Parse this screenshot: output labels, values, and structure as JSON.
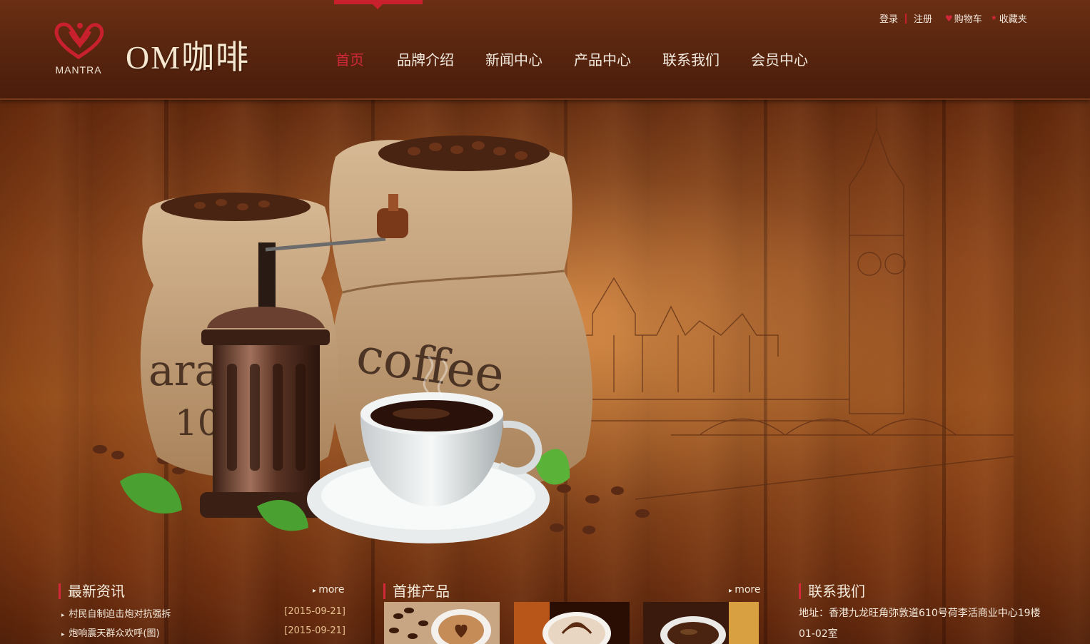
{
  "header": {
    "logo_mark_text": "MANTRA",
    "logo_title": "OM咖啡",
    "nav": [
      {
        "label": "首页",
        "active": true
      },
      {
        "label": "品牌介绍"
      },
      {
        "label": "新闻中心"
      },
      {
        "label": "产品中心"
      },
      {
        "label": "联系我们"
      },
      {
        "label": "会员中心"
      }
    ],
    "topbar": {
      "login": "登录",
      "register": "注册",
      "cart": "购物车",
      "favorites": "收藏夹"
    }
  },
  "hero": {
    "sack_text_left": "ara",
    "sack_text_left_2": "10",
    "sack_text_right": "coffee"
  },
  "news": {
    "title": "最新资讯",
    "more": "more",
    "items": [
      {
        "title": "村民自制迫击炮对抗强拆",
        "date": "[2015-09-21]"
      },
      {
        "title": "炮响震天群众欢呼(图)",
        "date": "[2015-09-21]"
      }
    ]
  },
  "products": {
    "title": "首推产品",
    "more": "more",
    "thumbs": [
      "heart-latte",
      "rosetta-latte",
      "black-coffee"
    ]
  },
  "contact": {
    "title": "联系我们",
    "address": "地址：香港九龙旺角弥敦道610号荷李活商业中心19楼01-02室"
  },
  "colors": {
    "accent": "#d2283a",
    "header_bg": "#5a260f",
    "text_light": "#f4eadc"
  }
}
